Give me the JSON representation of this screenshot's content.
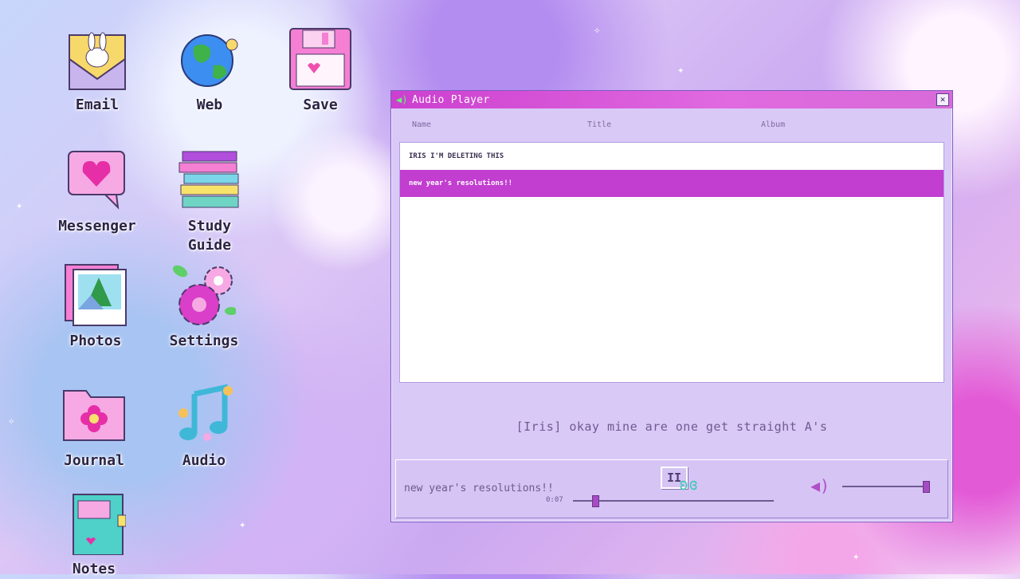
{
  "desktop": {
    "icons": [
      {
        "label": "Email",
        "icon": "envelope-bunny-icon"
      },
      {
        "label": "Web",
        "icon": "globe-icon"
      },
      {
        "label": "Save",
        "icon": "floppy-disk-icon"
      },
      {
        "label": "Messenger",
        "icon": "heart-chat-icon"
      },
      {
        "label": "Study Guide",
        "icon": "books-icon"
      },
      {
        "label": "Photos",
        "icon": "photos-icon"
      },
      {
        "label": "Settings",
        "icon": "gear-flower-icon"
      },
      {
        "label": "Journal",
        "icon": "folder-flower-icon"
      },
      {
        "label": "Audio",
        "icon": "music-note-icon"
      },
      {
        "label": "Notes",
        "icon": "notebook-icon"
      }
    ]
  },
  "audio_player": {
    "title": "Audio Player",
    "close_label": "✕",
    "columns": {
      "name": "Name",
      "title": "Title",
      "album": "Album"
    },
    "tracks": [
      {
        "name": "IRIS I'M DELETING THIS"
      },
      {
        "name": "new year's resolutions!!",
        "selected": true
      }
    ],
    "lyric": "[Iris] okay mine are one get straight A's",
    "now_playing": "new year's resolutions!!",
    "current_time": "0:07",
    "progress_fraction": 0.11,
    "volume_fraction": 0.97,
    "pause_label": "II",
    "colors": {
      "accent": "#c13ed0",
      "window_bg": "#d9c9f6"
    }
  }
}
